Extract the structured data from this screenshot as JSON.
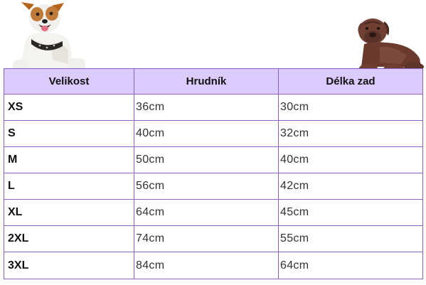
{
  "table": {
    "headers": [
      "Velikost",
      "Hrudník",
      "Délka zad"
    ],
    "rows": [
      [
        "XS",
        "36cm",
        "30cm"
      ],
      [
        "S",
        "40cm",
        "32cm"
      ],
      [
        "M",
        "50cm",
        "40cm"
      ],
      [
        "L",
        "56cm",
        "42cm"
      ],
      [
        "XL",
        "64cm",
        "45cm"
      ],
      [
        "2XL",
        "74cm",
        "55cm"
      ],
      [
        "3XL",
        "84cm",
        "64cm"
      ]
    ]
  },
  "colors": {
    "header_bg": "#dccbff",
    "border": "#8a63c8"
  },
  "images": {
    "left": "dog-jack-russell-icon",
    "right": "dog-mastiff-puppy-icon"
  }
}
